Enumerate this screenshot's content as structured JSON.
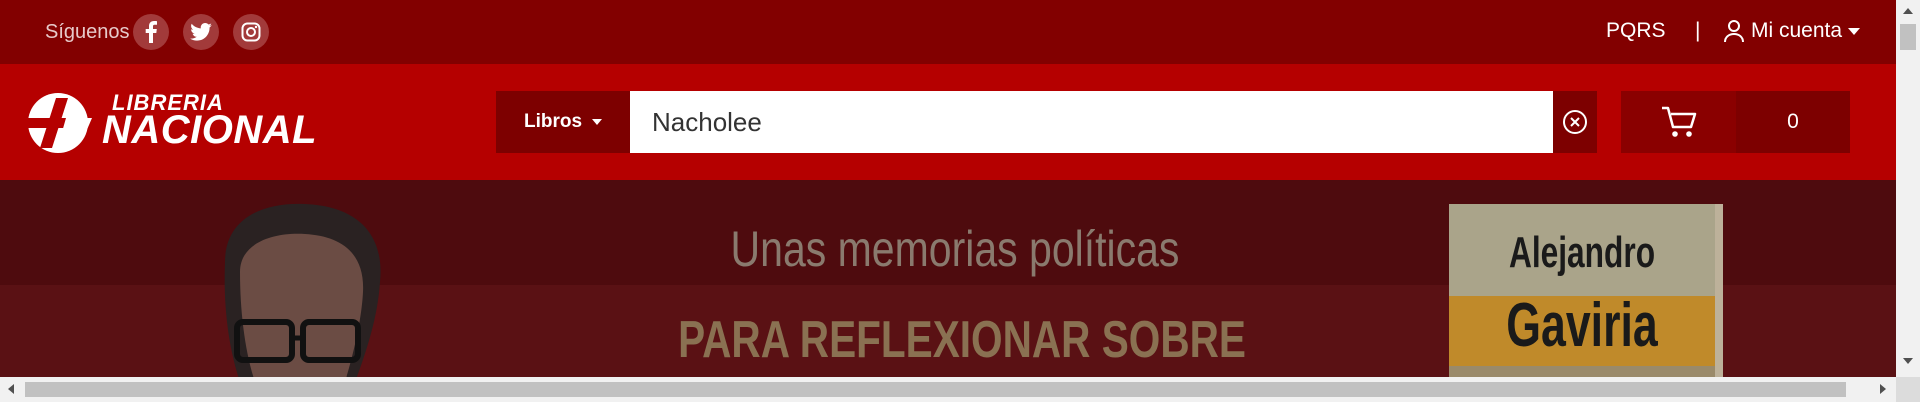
{
  "topbar": {
    "follow_label": "Síguenos",
    "social": [
      {
        "icon": "facebook-icon"
      },
      {
        "icon": "twitter-icon"
      },
      {
        "icon": "instagram-icon"
      }
    ],
    "pqrs_label": "PQRS",
    "separator": "|",
    "account_label": "Mi cuenta",
    "account_icon": "user-icon"
  },
  "header": {
    "logo_line_1": "LIBRERIA",
    "logo_line_2": "NACIONAL",
    "category_label": "Libros",
    "search_value": "Nacholee",
    "clear_icon": "clear-circle-icon",
    "cart_icon": "cart-icon",
    "cart_count": "0"
  },
  "banner": {
    "headline_1": "Unas memorias políticas",
    "headline_2": "PARA REFLEXIONAR SOBRE",
    "book_author_1": "Alejandro",
    "book_author_2": "Gaviria"
  },
  "colors": {
    "topbar_bg": "#820000",
    "header_bg": "#b50000",
    "banner_bg": "#4e0b0e",
    "dark_button": "#7d0000"
  }
}
